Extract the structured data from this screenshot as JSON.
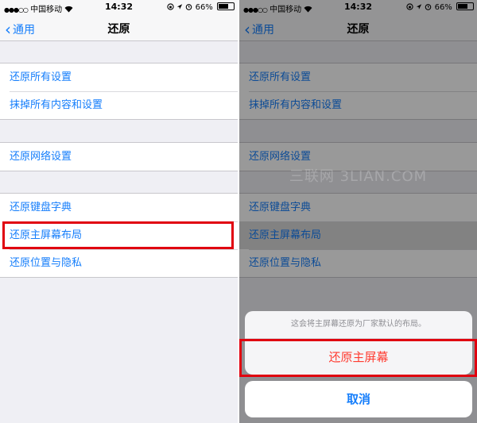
{
  "status_bar": {
    "carrier": "中国移动",
    "signal_dots": "●●●○○",
    "wifi_icon": "wifi-icon",
    "time": "14:32",
    "battery_percent": "66%",
    "battery_level": 0.66
  },
  "nav": {
    "back_label": "通用",
    "title": "还原"
  },
  "groups": [
    {
      "items": [
        "还原所有设置",
        "抹掉所有内容和设置"
      ]
    },
    {
      "items": [
        "还原网络设置"
      ]
    },
    {
      "items": [
        "还原键盘字典",
        "还原主屏幕布局",
        "还原位置与隐私"
      ]
    }
  ],
  "watermark": "三联网 3LIAN.COM",
  "action_sheet": {
    "message": "这会将主屏幕还原为厂家默认的布局。",
    "confirm_label": "还原主屏幕",
    "cancel_label": "取消"
  },
  "colors": {
    "link_blue": "#157efb",
    "destructive_red": "#ff3b30",
    "highlight_red": "#e0000f"
  }
}
